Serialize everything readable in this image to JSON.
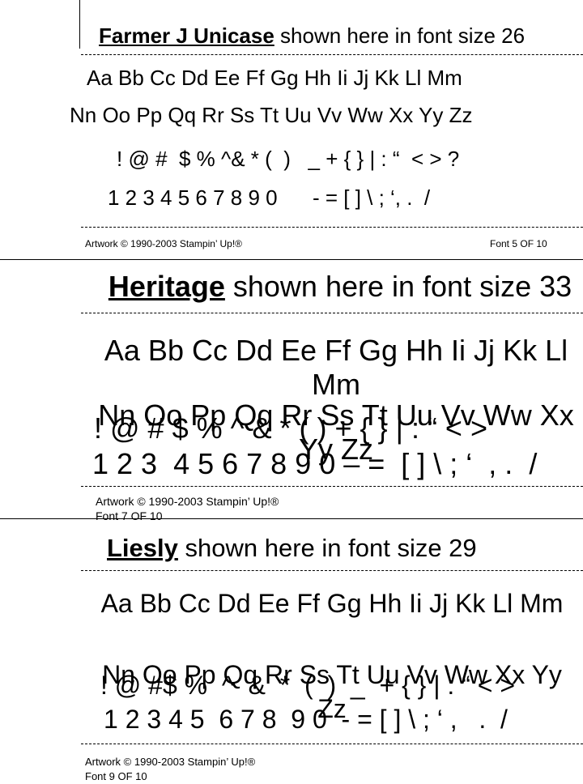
{
  "sections": [
    {
      "font_name": "Farmer J Unicase",
      "title_rest": " shown here in font size 26",
      "alphabet_line1": "Aa Bb Cc Dd Ee Ff Gg Hh Ii Jj Kk Ll Mm",
      "alphabet_line2": "Nn Oo Pp Qq Rr Ss Tt Uu Vv Ww Xx Yy Zz",
      "symbols": "! @ #  $ % ^& * (  )   _ + { } | : “  < > ?",
      "numbers": "1 2 3 4 5 6 7 8 9 0      - = [ ] \\ ; ‘, .  /",
      "copyright": "Artwork © 1990-2003 Stampin’ Up!®",
      "font_index": "Font 5 OF 10"
    },
    {
      "font_name": "Heritage",
      "title_rest": " shown here in font size 33",
      "alphabet_line1": "Aa Bb Cc Dd Ee Ff Gg Hh Ii Jj Kk Ll Mm",
      "alphabet_line2": "Nn Oo Pp Qq Rr Ss Tt Uu Vv Ww Xx Yy Zz",
      "symbols": "! @ # $ % ^ & * ( ) + { } | : “ < >",
      "numbers": "1 2 3  4 5 6 7 8 9 0 – =  [ ] \\ ; ‘  , .  /",
      "copyright": "Artwork © 1990-2003 Stampin’ Up!®",
      "font_index": "Font 7 OF 10"
    },
    {
      "font_name": "Liesly",
      "title_rest": " shown here in font size 29",
      "alphabet_line1": "Aa Bb Cc Dd Ee Ff Gg Hh Ii Jj Kk Ll Mm",
      "alphabet_line2": "Nn Oo Pp Qq Rr Ss Tt Uu Vv Ww Xx Yy Zz",
      "symbols": "! @ #$ %  ^  &  *  (  )  _  + { } | : “ < >",
      "numbers": "1 2 3 4 5  6 7 8  9 0  - = [ ] \\ ; ‘ ,   .  /",
      "copyright": "Artwork © 1990-2003 Stampin’ Up!®",
      "font_index": "Font 9 OF 10"
    }
  ]
}
